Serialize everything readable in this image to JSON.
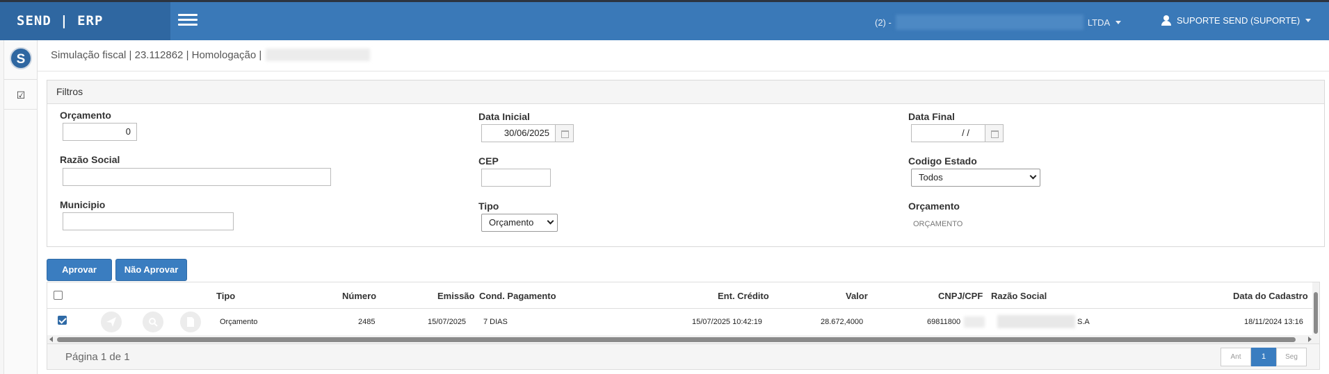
{
  "header": {
    "brand": "SEND | ERP",
    "company_prefix": "(2) -",
    "company_suffix": "LTDA",
    "user": "SUPORTE SEND (SUPORTE)"
  },
  "sidebar": {
    "logo_letter": "S"
  },
  "breadcrumb": "Simulação fiscal | 23.112862 | Homologação |",
  "filters": {
    "title": "Filtros",
    "orcamento_label": "Orçamento",
    "orcamento_value": "0",
    "data_inicial_label": "Data Inicial",
    "data_inicial_value": "30/06/2025",
    "data_final_label": "Data Final",
    "data_final_value": "/ /",
    "razao_social_label": "Razão Social",
    "razao_social_value": "",
    "cep_label": "CEP",
    "cep_value": "",
    "codigo_estado_label": "Codigo Estado",
    "codigo_estado_value": "Todos",
    "municipio_label": "Municipio",
    "municipio_value": "",
    "tipo_label": "Tipo",
    "tipo_value": "Orçamento",
    "orcamento2_label": "Orçamento",
    "orcamento2_value": "ORÇAMENTO"
  },
  "actions": {
    "approve": "Aprovar",
    "reject": "Não Aprovar"
  },
  "table": {
    "columns": {
      "tipo": "Tipo",
      "numero": "Número",
      "emissao": "Emissão",
      "cond_pagamento": "Cond. Pagamento",
      "ent_credito": "Ent. Crédito",
      "valor": "Valor",
      "cnpj": "CNPJ/CPF",
      "razao_social": "Razão Social",
      "data_cadastro": "Data do Cadastro"
    },
    "rows": [
      {
        "tipo": "Orçamento",
        "numero": "2485",
        "emissao": "15/07/2025",
        "cond_pagamento": "7 DIAS",
        "ent_credito": "15/07/2025 10:42:19",
        "valor": "28.672,4000",
        "cnpj": "69811800",
        "razao_social_suffix": "S.A",
        "data_cadastro": "18/11/2024 13:16"
      }
    ],
    "page_info": "Página 1 de 1",
    "pager": {
      "prev": "Ant",
      "current": "1",
      "next": "Seg"
    }
  },
  "colors": {
    "primary": "#3a79b8",
    "brand_bg": "#2f67a1",
    "button": "#3a7dc0"
  }
}
